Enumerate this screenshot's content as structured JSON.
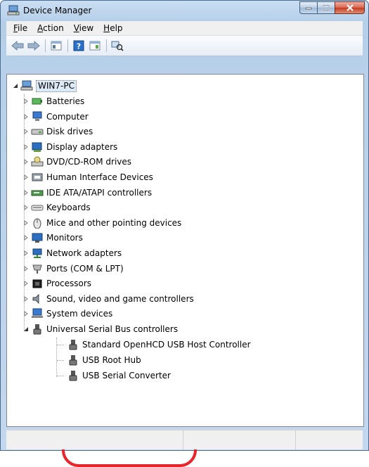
{
  "window": {
    "title": "Device Manager"
  },
  "menu": {
    "items": [
      {
        "label_ul": "F",
        "label_rest": "ile"
      },
      {
        "label_ul": "A",
        "label_rest": "ction"
      },
      {
        "label_ul": "V",
        "label_rest": "iew"
      },
      {
        "label_ul": "H",
        "label_rest": "elp"
      }
    ]
  },
  "toolbar": {
    "icons": [
      "back-arrow-icon",
      "forward-arrow-icon",
      "properties-icon",
      "help-icon",
      "update-driver-icon",
      "scan-hardware-icon"
    ]
  },
  "tree": {
    "root": "WIN7-PC",
    "categories": [
      "Batteries",
      "Computer",
      "Disk drives",
      "Display adapters",
      "DVD/CD-ROM drives",
      "Human Interface Devices",
      "IDE ATA/ATAPI controllers",
      "Keyboards",
      "Mice and other pointing devices",
      "Monitors",
      "Network adapters",
      "Ports (COM & LPT)",
      "Processors",
      "Sound, video and game controllers",
      "System devices",
      "Universal Serial Bus controllers"
    ],
    "usb_children": [
      "Standard OpenHCD USB Host Controller",
      "USB Root Hub",
      "USB Serial Converter"
    ]
  },
  "colors": {
    "highlight": "#e8252a",
    "selection": "#dceaf8"
  }
}
